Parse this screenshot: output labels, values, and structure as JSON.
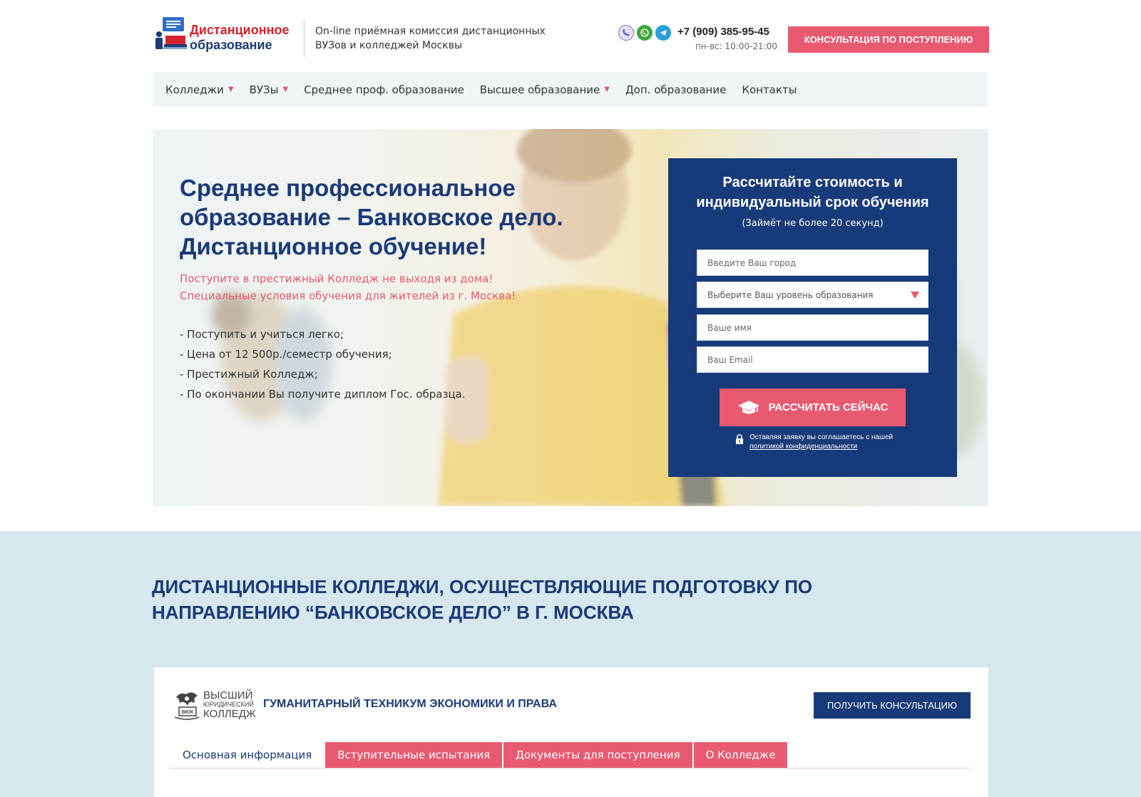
{
  "header": {
    "logo_line1": "Дистанционное",
    "logo_line2": "образование",
    "tagline": "On-line приёмная комиссия дистанционных ВУЗов и колледжей Москвы",
    "messengers": [
      {
        "name": "viber-icon",
        "color": "#7b68c6"
      },
      {
        "name": "whatsapp-icon",
        "color": "#3aa839"
      },
      {
        "name": "telegram-icon",
        "color": "#2a9ed8"
      }
    ],
    "phone": "+7 (909) 385-95-45",
    "hours": "пн-вс: 10:00-21:00",
    "consult_button": "Консультация по поступлению"
  },
  "nav": {
    "items": [
      {
        "label": "Колледжи",
        "has_dropdown": true
      },
      {
        "label": "ВУЗы",
        "has_dropdown": true
      },
      {
        "label": "Среднее проф. образование",
        "has_dropdown": false
      },
      {
        "label": "Высшее образование",
        "has_dropdown": true
      },
      {
        "label": "Доп. образование",
        "has_dropdown": false
      },
      {
        "label": "Контакты",
        "has_dropdown": false
      }
    ],
    "dropdown_glyph": "▼"
  },
  "hero": {
    "title": "Среднее профессиональное образование – Банковское дело. Дистанционное обучение!",
    "subtitle_line1": "Поступите в престижный Колледж не выходя из дома!",
    "subtitle_line2": "Специальные условия обучения для жителей из г. Москва!",
    "bullets": [
      "- Поступить и учиться легко;",
      "- Цена от 12 500р./семестр обучения;",
      "- Престижный Колледж;",
      "- По окончании Вы получите диплом Гос. образца."
    ]
  },
  "form": {
    "title": "Рассчитайте стоимость и индивидуальный срок обучения",
    "note": "(Займёт не более 20 секунд)",
    "city_placeholder": "Введите Ваш город",
    "level_select": "Выберите Ваш уровень образования",
    "name_placeholder": "Ваше имя",
    "email_placeholder": "Ваш Email",
    "submit_label": "Рассчитать сейчас",
    "privacy_text": "Оставляя заявку вы соглашаетесь с нашей",
    "privacy_link": "политикой конфиденциальности"
  },
  "colleges": {
    "section_title": "Дистанционные колледжи, осуществляющие подготовку по направлению “Банковское дело” в г. Москва",
    "card": {
      "logo_line1": "ВЫСШИЙ",
      "logo_line2": "ЮРИДИЧЕСКИЙ",
      "logo_line3": "КОЛЛЕДЖ",
      "logo_badge": "ВЮК",
      "name": "Гуманитарный техникум экономики и права",
      "consult_button": "Получить консультацию",
      "tabs": [
        {
          "label": "Основная информация",
          "active": true
        },
        {
          "label": "Вступительные испытания",
          "active": false
        },
        {
          "label": "Документы для поступления",
          "active": false
        },
        {
          "label": "О Колледже",
          "active": false
        }
      ]
    }
  },
  "colors": {
    "brand_navy": "#173b7a",
    "brand_pink": "#e85a70",
    "brand_red": "#d2232f",
    "section_bg": "#d6e7ee"
  }
}
